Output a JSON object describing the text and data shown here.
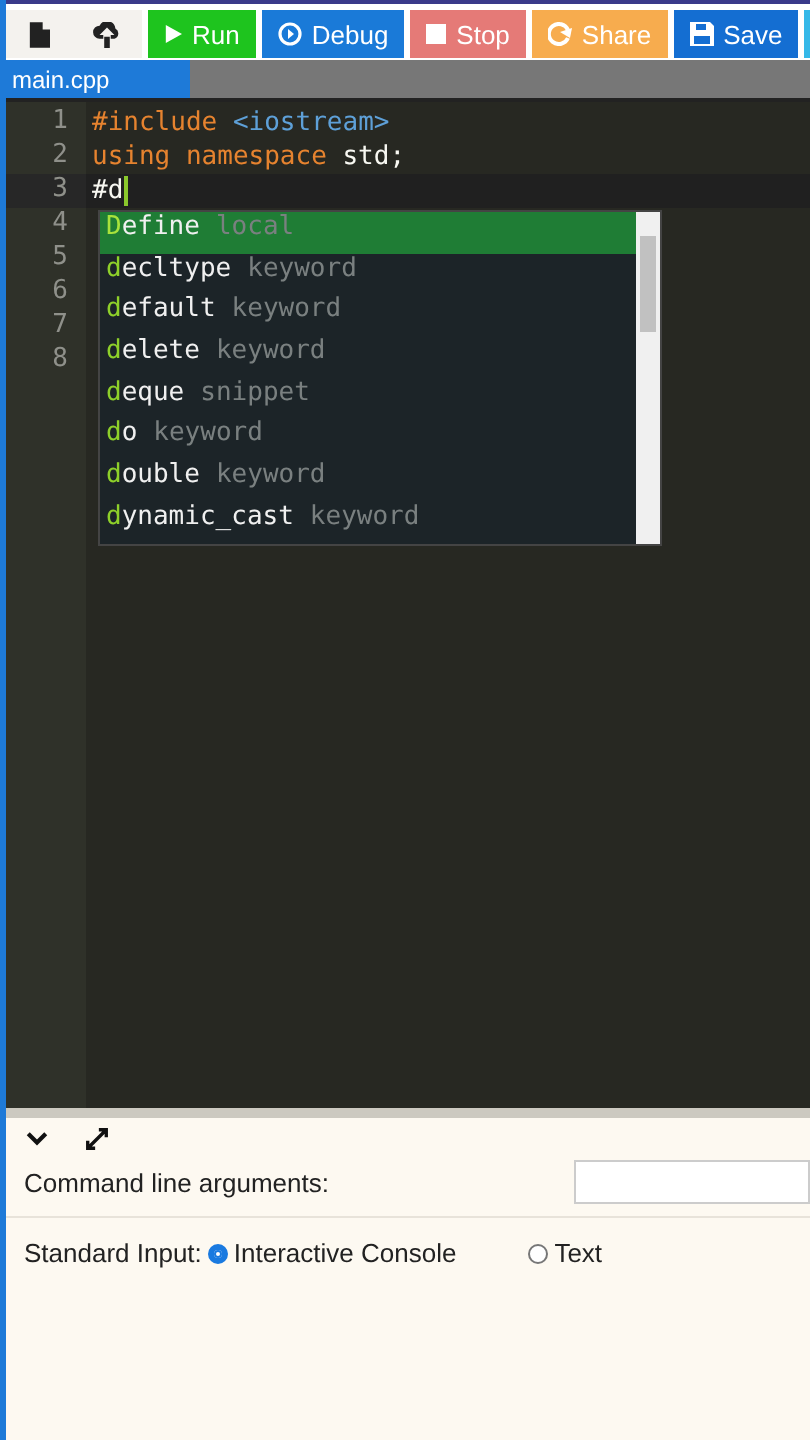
{
  "toolbar": {
    "buttons": [
      {
        "kind": "run",
        "label": "Run",
        "color": "#1ec41e"
      },
      {
        "kind": "debug",
        "label": "Debug",
        "color": "#1a7ad8"
      },
      {
        "kind": "stop",
        "label": "Stop",
        "color": "#e57a77"
      },
      {
        "kind": "share",
        "label": "Share",
        "color": "#f7ac4e"
      },
      {
        "kind": "save",
        "label": "Save",
        "color": "#146ed2"
      }
    ]
  },
  "tabs": [
    {
      "label": "main.cpp",
      "selected": true
    }
  ],
  "editor": {
    "lines": [
      {
        "number": "1",
        "tokens": [
          {
            "kind": "keyword",
            "text": "#include"
          },
          {
            "kind": "string",
            "text": " <iostream>"
          }
        ]
      },
      {
        "number": "2",
        "tokens": [
          {
            "kind": "keyword",
            "text": "using namespace"
          },
          {
            "kind": "plain",
            "text": " std;"
          }
        ]
      },
      {
        "number": "3",
        "tokens": [
          {
            "kind": "plain",
            "text": "#d"
          }
        ]
      },
      {
        "number": "4"
      },
      {
        "number": "5"
      },
      {
        "number": "6"
      },
      {
        "number": "7"
      },
      {
        "number": "8"
      }
    ],
    "autocomplete": [
      {
        "label": "Define",
        "meta": "local",
        "selected": true
      },
      {
        "label": "decltype",
        "meta": "keyword",
        "selected": false
      },
      {
        "label": "default",
        "meta": "keyword",
        "selected": false
      },
      {
        "label": "delete",
        "meta": "keyword",
        "selected": false
      },
      {
        "label": "deque",
        "meta": "snippet",
        "selected": false
      },
      {
        "label": "do",
        "meta": "keyword",
        "selected": false
      },
      {
        "label": "double",
        "meta": "keyword",
        "selected": false
      },
      {
        "label": "dynamic_cast",
        "meta": "keyword",
        "selected": false
      }
    ]
  },
  "panel": {
    "arguments_label": "Command line arguments:",
    "stdin_label": "Standard Input:",
    "stdin_options": [
      {
        "label": "Interactive Console",
        "selected": true
      },
      {
        "label": "Text",
        "selected": false
      }
    ]
  }
}
